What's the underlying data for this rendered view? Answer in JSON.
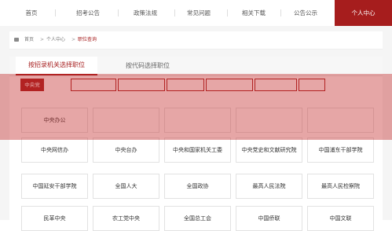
{
  "colors": {
    "brand": "#a61d1d",
    "background": "#f5f5f5"
  },
  "topnav": {
    "items": [
      {
        "label": "首页"
      },
      {
        "label": "招考公告"
      },
      {
        "label": "政策法规"
      },
      {
        "label": "常见问题"
      },
      {
        "label": "相关下载"
      },
      {
        "label": "公告公示"
      },
      {
        "label": "个人中心",
        "active": true
      }
    ]
  },
  "breadcrumb": {
    "icon": "home-icon",
    "items": [
      "首页",
      "个人中心",
      "职位查询"
    ],
    "separator": ">"
  },
  "search": {
    "tabs": [
      {
        "label": "按招录机关选择职位",
        "active": true
      },
      {
        "label": "按代码选择职位"
      }
    ]
  },
  "categories": [
    {
      "label": "中央党",
      "active": true
    },
    {
      "label": ""
    },
    {
      "label": ""
    },
    {
      "label": ""
    },
    {
      "label": ""
    },
    {
      "label": ""
    },
    {
      "label": ""
    }
  ],
  "institutions": [
    {
      "label": "中央办公"
    },
    {
      "label": ""
    },
    {
      "label": ""
    },
    {
      "label": ""
    },
    {
      "label": ""
    },
    {
      "label": "中央网信办"
    },
    {
      "label": "中央台办"
    },
    {
      "label": "中央和国家机关工委"
    },
    {
      "label": "中央党史和文献研究院"
    },
    {
      "label": "中国浦东干部学院"
    },
    {
      "label": "中国延安干部学院"
    },
    {
      "label": "全国人大"
    },
    {
      "label": "全国政协"
    },
    {
      "label": "最高人民法院"
    },
    {
      "label": "最高人民检察院"
    },
    {
      "label": "民革中央"
    },
    {
      "label": "农工党中央"
    },
    {
      "label": "全国总工会"
    },
    {
      "label": "中国侨联"
    },
    {
      "label": "中国文联"
    }
  ]
}
